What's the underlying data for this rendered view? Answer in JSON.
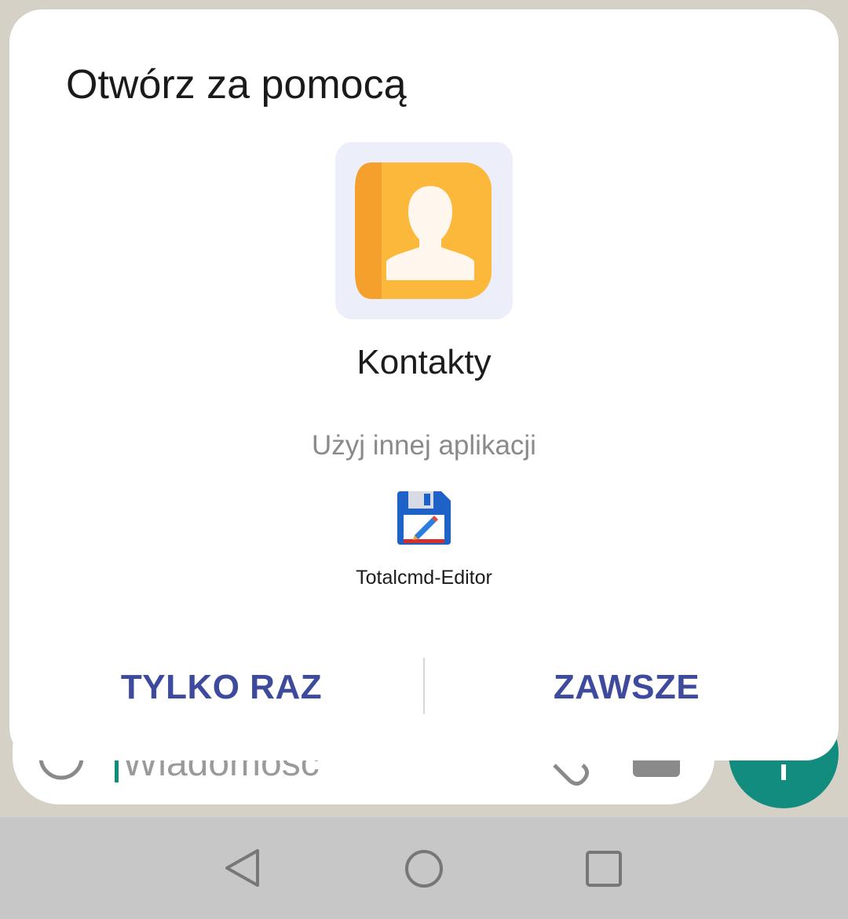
{
  "dialog": {
    "title": "Otwórz za pomocą",
    "primary_app": {
      "name": "Kontakty",
      "icon": "contacts-icon"
    },
    "other_apps_label": "Użyj innej aplikacji",
    "other_apps": [
      {
        "name": "Totalcmd-Editor",
        "icon": "floppy-edit-icon"
      }
    ],
    "buttons": {
      "once": "TYLKO RAZ",
      "always": "ZAWSZE"
    }
  },
  "background": {
    "message_placeholder": "Wiadomość"
  },
  "colors": {
    "accent_button": "#3e4b9c",
    "whatsapp_green": "#128c7e",
    "contacts_orange": "#fbb83a"
  }
}
